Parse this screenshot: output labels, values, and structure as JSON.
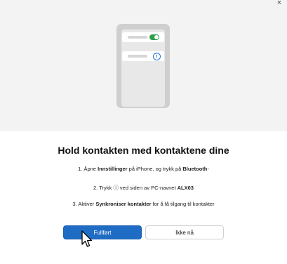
{
  "window": {
    "close_glyph": "×"
  },
  "illustration": {
    "phone": "phone-illustration",
    "rows": [
      "toggle-row",
      "info-row"
    ],
    "info_glyph": "i"
  },
  "dialog": {
    "title": "Hold kontakten med kontaktene dine",
    "steps": [
      {
        "prefix": "1. Åpne ",
        "bold1": "Innstillinger",
        "middle": " på iPhone, og trykk på ",
        "bold2": "Bluetooth",
        "suffix": "-"
      },
      {
        "prefix": "2. Trykk ⓘ ved siden av PC-navnet ",
        "bold1": "ALX03",
        "middle": "",
        "bold2": "",
        "suffix": ""
      },
      {
        "prefix": "3. Aktiver ",
        "bold1": "Synkroniser kontakter",
        "middle": " for å få tilgang til kontakter",
        "bold2": "",
        "suffix": ""
      }
    ]
  },
  "buttons": {
    "primary_label": "Fullført",
    "secondary_label": "Ikke nå"
  },
  "colors": {
    "accent": "#1f6cc4",
    "toggle_on": "#2e9e49",
    "hero_bg": "#f3f3f3"
  }
}
